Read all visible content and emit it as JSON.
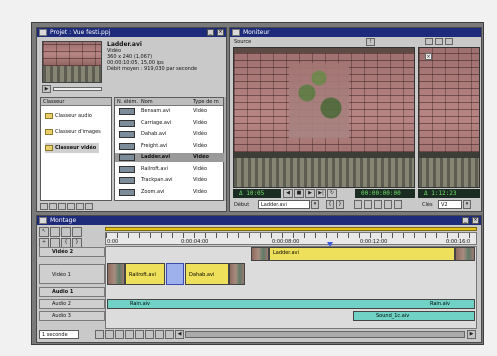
{
  "project": {
    "title": "Projet : Vue festi.ppj",
    "clip_name": "Ladder.avi",
    "clip_type": "Vidéo",
    "clip_size": "360 x 240 (1,067)",
    "clip_duration": "00:00:10:05, 15,00 ips",
    "clip_rate": "Débit moyen : 919,030 par seconde",
    "col_folder": "Classeur",
    "col_icons": "N. élém.",
    "col_name": "Nom",
    "col_type": "Type de m",
    "folders": [
      "Classeur audio",
      "Classeur d'images",
      "Classeur vidéo"
    ],
    "files": [
      {
        "name": "Bensam.avi",
        "type": "Vidéo"
      },
      {
        "name": "Carriage.avi",
        "type": "Vidéo"
      },
      {
        "name": "Dahab.avi",
        "type": "Vidéo"
      },
      {
        "name": "Freight.avi",
        "type": "Vidéo"
      },
      {
        "name": "Ladder.avi",
        "type": "Vidéo"
      },
      {
        "name": "Railroft.avi",
        "type": "Vidéo"
      },
      {
        "name": "Trackpan.avi",
        "type": "Vidéo"
      },
      {
        "name": "Zoom.avi",
        "type": "Vidéo"
      }
    ]
  },
  "monitor": {
    "title": "Moniteur",
    "source_label": "Source",
    "tc_left_1": "Δ 10:05",
    "tc_left_2": "00:00:00:00",
    "tc_right": "Δ 1:12:23",
    "start_label": "Début",
    "source_select": "Ladder.avi",
    "prog_select": "Clés",
    "prog_value": "V2"
  },
  "timeline": {
    "title": "Montage",
    "ticks": [
      "0:00",
      "0:00:04:00",
      "0:00:08:00",
      "0:00:12:00",
      "0:00:16:0"
    ],
    "tracks": [
      {
        "name": "Vidéo 2"
      },
      {
        "name": "Vidéo 1"
      },
      {
        "name": "Audio 1"
      },
      {
        "name": "Audio 2"
      },
      {
        "name": "Audio 3"
      }
    ],
    "clips": {
      "v2_ladder": "Ladder.avi",
      "v1_railroft": "Railroft.avi",
      "v1_dahab": "Dahab.avi",
      "a2_rain_left": "Rain.aiv",
      "a2_rain_right": "Rain.aiv",
      "a3_sound": "Sound_1c.aiv"
    },
    "scale_label": "1 seconde"
  }
}
